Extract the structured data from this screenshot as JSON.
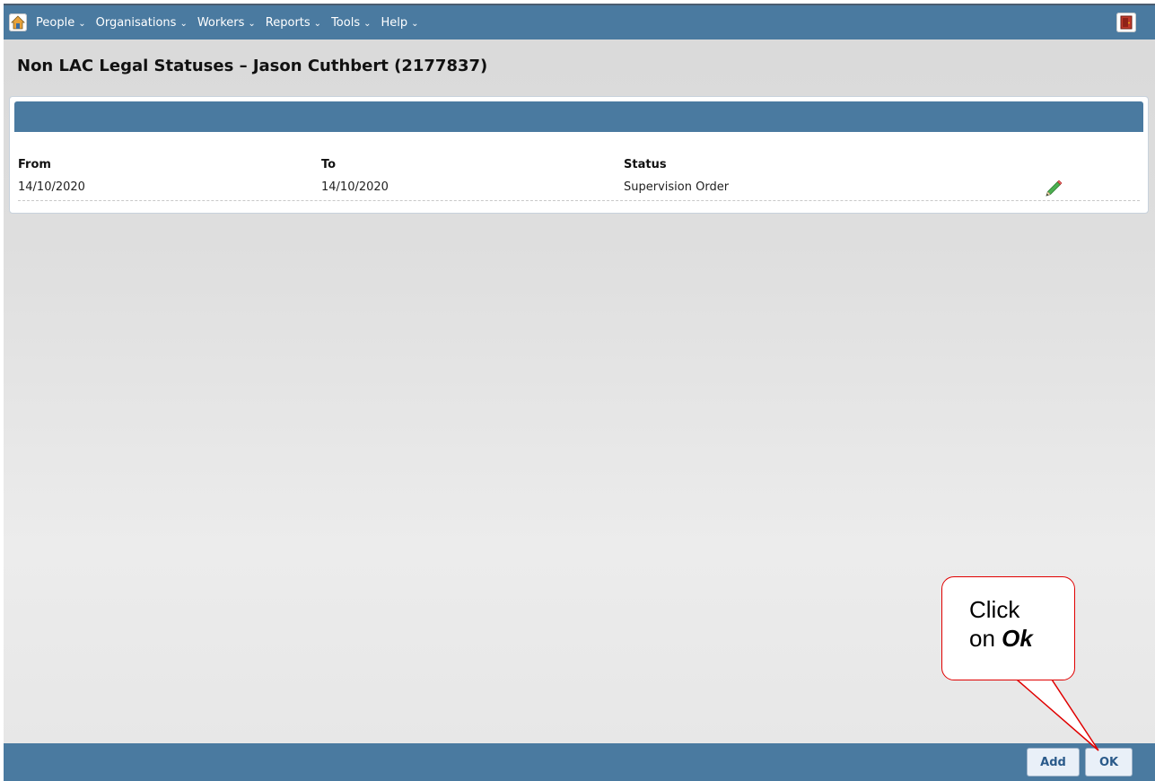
{
  "nav": {
    "items": [
      {
        "label": "People"
      },
      {
        "label": "Organisations"
      },
      {
        "label": "Workers"
      },
      {
        "label": "Reports"
      },
      {
        "label": "Tools"
      },
      {
        "label": "Help"
      }
    ],
    "chevron": "⌄"
  },
  "page": {
    "title": "Non LAC Legal Statuses – Jason Cuthbert (2177837)"
  },
  "table": {
    "columns": [
      "From",
      "To",
      "Status"
    ],
    "rows": [
      {
        "from": "14/10/2020",
        "to": "14/10/2020",
        "status": "Supervision Order"
      }
    ]
  },
  "footer": {
    "add_label": "Add",
    "ok_label": "OK"
  },
  "callout": {
    "line1": "Click",
    "line2_prefix": "on ",
    "line2_emphasis": "Ok"
  },
  "colors": {
    "bar_blue": "#4a7aa0",
    "callout_red": "#e00000"
  },
  "icons": {
    "home": "home-icon",
    "exit": "exit-door-icon",
    "edit": "pencil-icon"
  }
}
